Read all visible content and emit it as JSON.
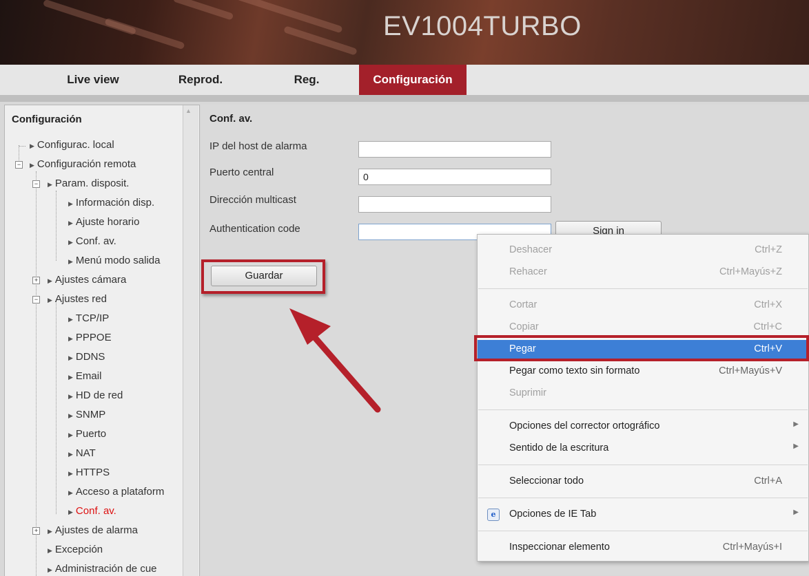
{
  "banner": {
    "title": "EV1004TURBO"
  },
  "nav": {
    "items": [
      {
        "label": "Live view"
      },
      {
        "label": "Reprod."
      },
      {
        "label": "Reg."
      },
      {
        "label": "Configuración"
      }
    ],
    "active": "Configuración",
    "active_color": "#a3202a"
  },
  "sidebar": {
    "title": "Configuración",
    "items": [
      {
        "label": "Configurac. local"
      },
      {
        "label": "Configuración remota"
      },
      {
        "label": "Param. disposit."
      },
      {
        "label": "Información disp."
      },
      {
        "label": "Ajuste horario"
      },
      {
        "label": "Conf. av."
      },
      {
        "label": "Menú modo salida"
      },
      {
        "label": "Ajustes cámara"
      },
      {
        "label": "Ajustes red"
      },
      {
        "label": "TCP/IP"
      },
      {
        "label": "PPPOE"
      },
      {
        "label": "DDNS"
      },
      {
        "label": "Email"
      },
      {
        "label": "HD de red"
      },
      {
        "label": "SNMP"
      },
      {
        "label": "Puerto"
      },
      {
        "label": "NAT"
      },
      {
        "label": "HTTPS"
      },
      {
        "label": "Acceso a plataform"
      },
      {
        "label": "Conf. av."
      },
      {
        "label": "Ajustes de alarma"
      },
      {
        "label": "Excepción"
      },
      {
        "label": "Administración de cue"
      }
    ],
    "active_item": "Conf. av."
  },
  "main": {
    "section_title": "Conf. av.",
    "fields": [
      {
        "label": "IP del host de alarma",
        "value": ""
      },
      {
        "label": "Puerto central",
        "value": "0"
      },
      {
        "label": "Dirección multicast",
        "value": ""
      },
      {
        "label": "Authentication code",
        "value": ""
      }
    ],
    "sign_in_label": "Sign in",
    "save_label": "Guardar"
  },
  "context_menu": {
    "items": [
      {
        "label": "Deshacer",
        "shortcut": "Ctrl+Z",
        "disabled": true
      },
      {
        "label": "Rehacer",
        "shortcut": "Ctrl+Mayús+Z",
        "disabled": true
      },
      {
        "label": "Cortar",
        "shortcut": "Ctrl+X",
        "disabled": true
      },
      {
        "label": "Copiar",
        "shortcut": "Ctrl+C",
        "disabled": true
      },
      {
        "label": "Pegar",
        "shortcut": "Ctrl+V",
        "selected": true
      },
      {
        "label": "Pegar como texto sin formato",
        "shortcut": "Ctrl+Mayús+V"
      },
      {
        "label": "Suprimir",
        "shortcut": "",
        "disabled": true
      },
      {
        "label": "Opciones del corrector ortográfico",
        "submenu": true
      },
      {
        "label": "Sentido de la escritura",
        "submenu": true
      },
      {
        "label": "Seleccionar todo",
        "shortcut": "Ctrl+A"
      },
      {
        "label": "Opciones de IE Tab",
        "submenu": true,
        "icon": "ie-tab-icon"
      },
      {
        "label": "Inspeccionar elemento",
        "shortcut": "Ctrl+Mayús+I"
      }
    ],
    "selected_color": "#3d7fd6"
  },
  "annotations": {
    "highlight_color": "#b5202a"
  }
}
